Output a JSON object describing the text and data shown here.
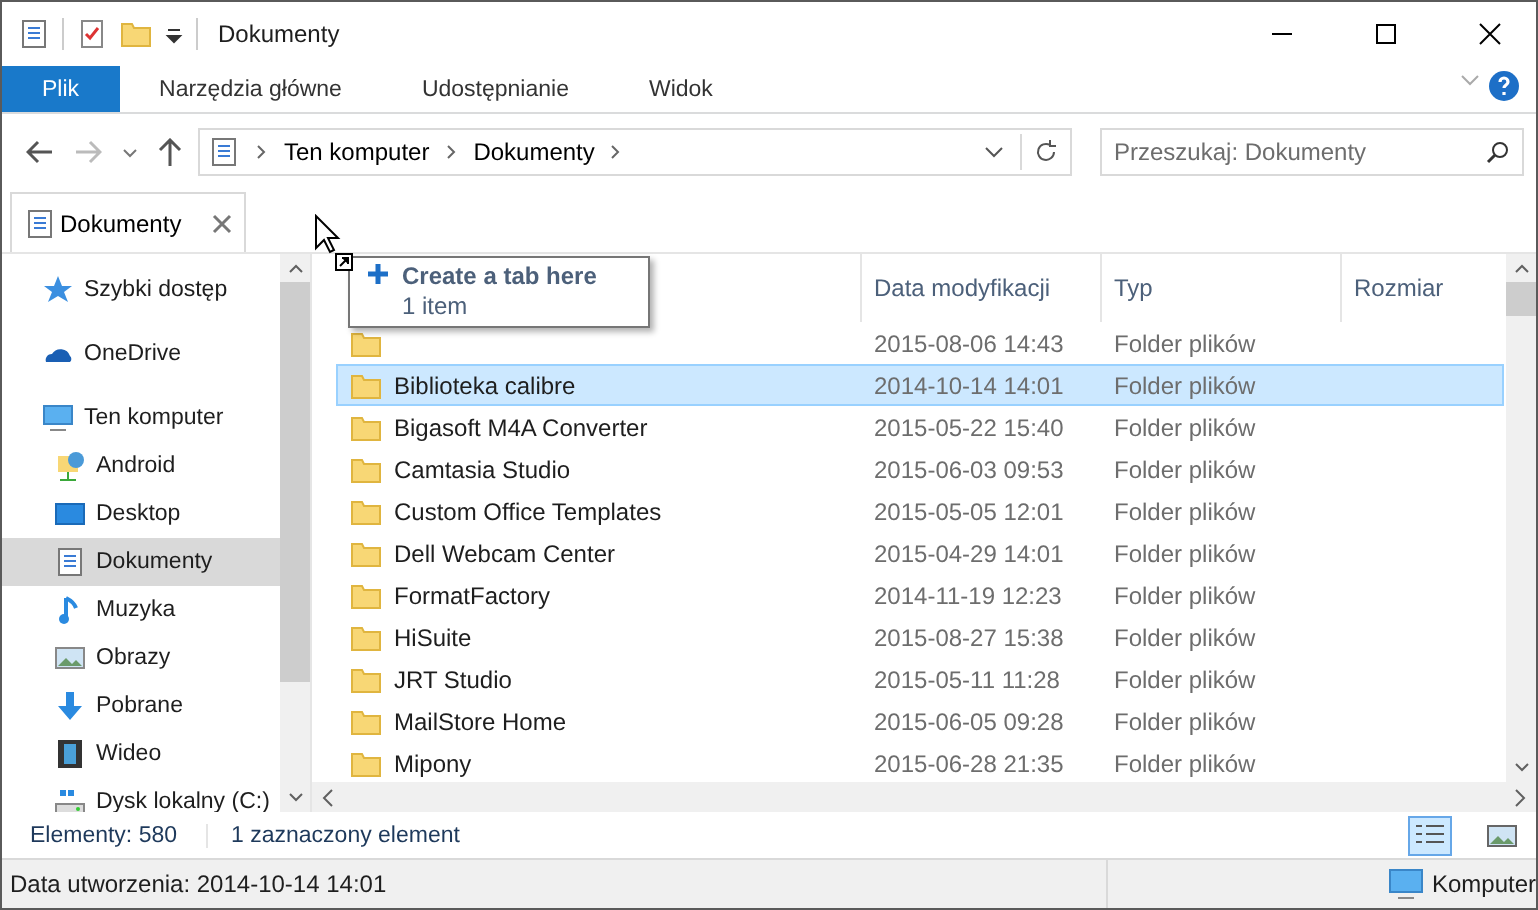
{
  "window": {
    "title": "Dokumenty"
  },
  "ribbon_tabs": [
    {
      "label": "Plik",
      "selected": true
    },
    {
      "label": "Narzędzia główne",
      "selected": false
    },
    {
      "label": "Udostępnianie",
      "selected": false
    },
    {
      "label": "Widok",
      "selected": false
    }
  ],
  "address": {
    "path": [
      "Ten komputer",
      "Dokumenty"
    ]
  },
  "search": {
    "placeholder": "Przeszukaj: Dokumenty"
  },
  "tabs": [
    {
      "label": "Dokumenty",
      "selected": true
    }
  ],
  "tooltip": {
    "title": "Create a tab here",
    "subtitle": "1 item"
  },
  "sidebar": {
    "items": [
      {
        "label": "Szybki dostęp",
        "selected": false
      },
      {
        "label": "OneDrive",
        "selected": false
      },
      {
        "label": "Ten komputer",
        "selected": false,
        "children": [
          {
            "label": "Android",
            "selected": false
          },
          {
            "label": "Desktop",
            "selected": false
          },
          {
            "label": "Dokumenty",
            "selected": true
          },
          {
            "label": "Muzyka",
            "selected": false
          },
          {
            "label": "Obrazy",
            "selected": false
          },
          {
            "label": "Pobrane",
            "selected": false
          },
          {
            "label": "Wideo",
            "selected": false
          },
          {
            "label": "Dysk lokalny (C:)",
            "selected": false
          }
        ]
      }
    ]
  },
  "table": {
    "columns": [
      "Data modyfikacji",
      "Typ",
      "Rozmiar"
    ],
    "rows": [
      {
        "date": "2015-08-06 14:43",
        "type": "Folder plików",
        "selected": false
      },
      {
        "name": "Biblioteka calibre",
        "date": "2014-10-14 14:01",
        "type": "Folder plików",
        "selected": true
      },
      {
        "name": "Bigasoft M4A Converter",
        "date": "2015-05-22 15:40",
        "type": "Folder plików",
        "selected": false
      },
      {
        "name": "Camtasia Studio",
        "date": "2015-06-03 09:53",
        "type": "Folder plików",
        "selected": false
      },
      {
        "name": "Custom Office Templates",
        "date": "2015-05-05 12:01",
        "type": "Folder plików",
        "selected": false
      },
      {
        "name": "Dell Webcam Center",
        "date": "2015-04-29 14:01",
        "type": "Folder plików",
        "selected": false
      },
      {
        "name": "FormatFactory",
        "date": "2014-11-19 12:23",
        "type": "Folder plików",
        "selected": false
      },
      {
        "name": "HiSuite",
        "date": "2015-08-27 15:38",
        "type": "Folder plików",
        "selected": false
      },
      {
        "name": "JRT Studio",
        "date": "2015-05-11 11:28",
        "type": "Folder plików",
        "selected": false
      },
      {
        "name": "MailStore Home",
        "date": "2015-06-05 09:28",
        "type": "Folder plików",
        "selected": false
      },
      {
        "name": "Mipony",
        "date": "2015-06-28 21:35",
        "type": "Folder plików",
        "selected": false
      }
    ]
  },
  "status": {
    "count": "Elementy: 580",
    "selection": "1 zaznaczony element",
    "views": [
      {
        "kind": "details",
        "selected": true
      },
      {
        "kind": "thumbs",
        "selected": false
      }
    ]
  },
  "details_bar": {
    "created": "Data utworzenia: 2014-10-14 14:01",
    "location": "Komputer"
  }
}
